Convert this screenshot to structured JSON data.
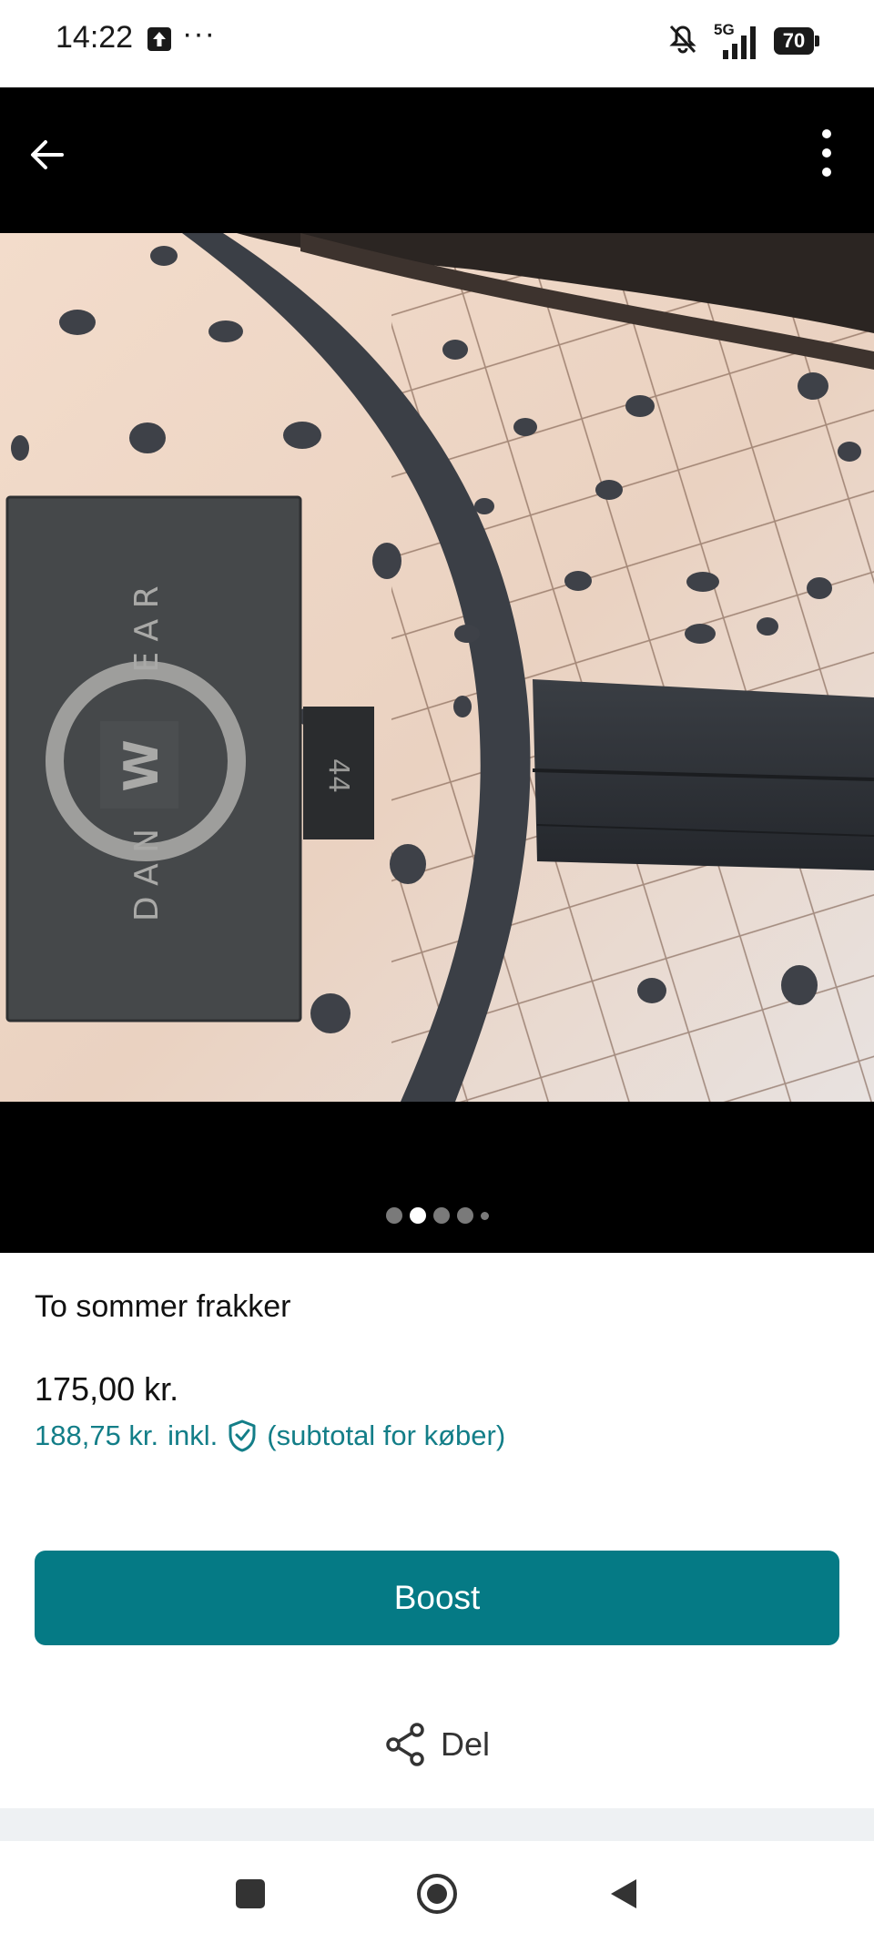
{
  "status_bar": {
    "time": "14:22",
    "overflow": "···",
    "network": "5G",
    "battery": "70",
    "icons": [
      "upload-icon",
      "vibrate-off-icon",
      "signal-icon",
      "battery-icon"
    ]
  },
  "toolbar": {
    "back_icon": "arrow-left-icon",
    "menu_icon": "more-vertical-icon"
  },
  "photo": {
    "brand_label": "DANWEAR",
    "size_label": "44",
    "pager": {
      "count": 5,
      "active_index": 1
    }
  },
  "listing": {
    "title": "To sommer frakker",
    "price": "175,00 kr.",
    "subtotal_price": "188,75 kr.",
    "subtotal_incl": "inkl.",
    "subtotal_note": "(subtotal for køber)"
  },
  "actions": {
    "boost_label": "Boost",
    "share_label": "Del"
  },
  "colors": {
    "accent": "#057a85",
    "link": "#137e88",
    "viewer_bg": "#000000"
  }
}
